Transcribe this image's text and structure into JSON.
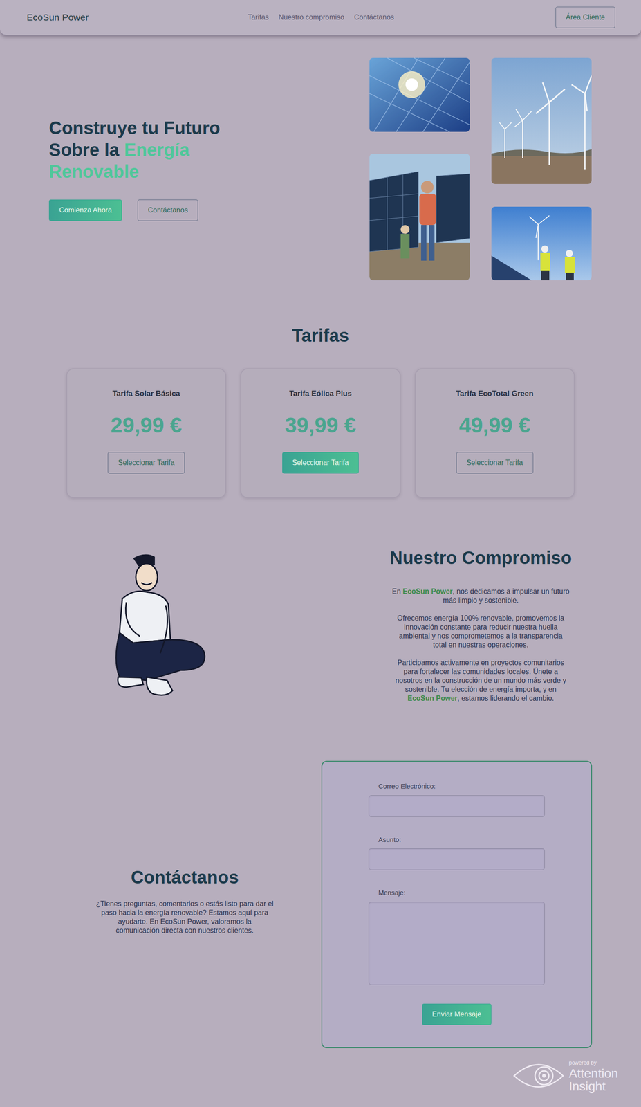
{
  "navbar": {
    "brand": "EcoSun Power",
    "links": [
      "Tarifas",
      "Nuestro compromiso",
      "Contáctanos"
    ],
    "client_button": "Área Cliente"
  },
  "hero": {
    "title_dark": "Construye tu Futuro Sobre la ",
    "title_accent": "Energía Renovable",
    "buttons": [
      {
        "label": "Comienza Ahora",
        "selected": true
      },
      {
        "label": "Contáctanos",
        "selected": false
      }
    ],
    "photos": [
      {
        "kind": "solar"
      },
      {
        "kind": "worker"
      },
      {
        "kind": "wind"
      },
      {
        "kind": "engineers"
      }
    ]
  },
  "tariffs": {
    "title": "Tarifas",
    "plans": [
      {
        "name": "Tarifa Solar Básica",
        "price": "29,99 €",
        "button": "Seleccionar Tarifa",
        "selected": false
      },
      {
        "name": "Tarifa Eólica Plus",
        "price": "39,99 €",
        "button": "Seleccionar Tarifa",
        "selected": true
      },
      {
        "name": "Tarifa EcoTotal Green",
        "price": "49,99 €",
        "button": "Seleccionar Tarifa",
        "selected": false
      }
    ]
  },
  "commitment": {
    "title": "Nuestro Compromiso",
    "paragraphs": [
      [
        {
          "text": "En ",
          "strong": false
        },
        {
          "text": "EcoSun Power",
          "strong": true
        },
        {
          "text": ", nos dedicamos a impulsar un futuro más limpio y sostenible.",
          "strong": false
        }
      ],
      [
        {
          "text": "Ofrecemos energía 100% renovable, promovemos la innovación constante para reducir nuestra huella ambiental y nos comprometemos a la transparencia total en nuestras operaciones.",
          "strong": false
        }
      ],
      [
        {
          "text": "Participamos activamente en proyectos comunitarios para fortalecer las comunidades locales. Únete a nosotros en la construcción de un mundo más verde y sostenible. Tu elección de energía importa, y en ",
          "strong": false
        },
        {
          "text": "EcoSun Power",
          "strong": true
        },
        {
          "text": ", estamos liderando el cambio.",
          "strong": false
        }
      ]
    ]
  },
  "contact": {
    "title": "Contáctanos",
    "text": "¿Tienes preguntas, comentarios o estás listo para dar el paso hacia la energía renovable? Estamos aquí para ayudarte. En EcoSun Power, valoramos la comunicación directa con nuestros clientes.",
    "fields": [
      {
        "label": "Correo Electrónico:",
        "kind": "input"
      },
      {
        "label": "Asunto:",
        "kind": "input"
      },
      {
        "label": "Mensaje:",
        "kind": "textarea"
      }
    ],
    "submit": "Enviar Mensaje"
  },
  "watermark": {
    "small": "powered by",
    "name": "Attention Insight"
  }
}
